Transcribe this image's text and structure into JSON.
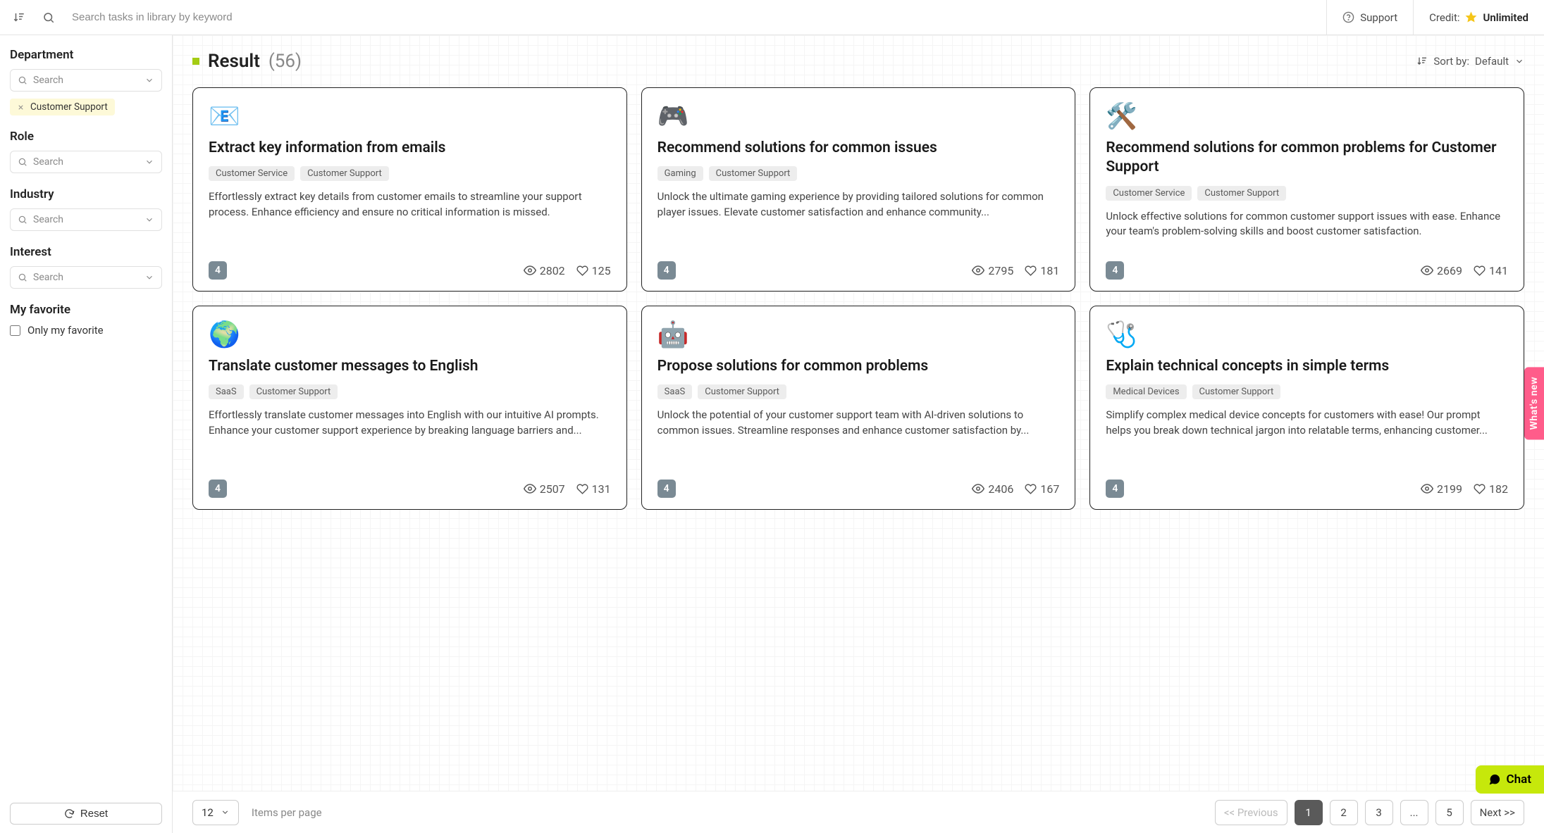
{
  "topbar": {
    "search_placeholder": "Search tasks in library by keyword",
    "support_label": "Support",
    "credit_label": "Credit:",
    "credit_value": "Unlimited"
  },
  "sidebar": {
    "filters": {
      "department": {
        "heading": "Department",
        "placeholder": "Search",
        "chip": "Customer Support"
      },
      "role": {
        "heading": "Role",
        "placeholder": "Search"
      },
      "industry": {
        "heading": "Industry",
        "placeholder": "Search"
      },
      "interest": {
        "heading": "Interest",
        "placeholder": "Search"
      }
    },
    "favorite": {
      "heading": "My favorite",
      "checkbox_label": "Only my favorite"
    },
    "reset_label": "Reset"
  },
  "result": {
    "title": "Result",
    "count": "(56)",
    "sort_prefix": "Sort by:",
    "sort_value": "Default"
  },
  "cards": [
    {
      "emoji": "📧",
      "title": "Extract key information from emails",
      "tags": [
        "Customer Service",
        "Customer Support"
      ],
      "desc": "Effortlessly extract key details from customer emails to streamline your support process. Enhance efficiency and ensure no critical information is missed.",
      "rating": "4",
      "views": "2802",
      "likes": "125"
    },
    {
      "emoji": "🎮",
      "title": "Recommend solutions for common issues",
      "tags": [
        "Gaming",
        "Customer Support"
      ],
      "desc": "Unlock the ultimate gaming experience by providing tailored solutions for common player issues. Elevate customer satisfaction and enhance community...",
      "rating": "4",
      "views": "2795",
      "likes": "181"
    },
    {
      "emoji": "🛠️",
      "title": "Recommend solutions for common problems for Customer Support",
      "tags": [
        "Customer Service",
        "Customer Support"
      ],
      "desc": "Unlock effective solutions for common customer support issues with ease. Enhance your team's problem-solving skills and boost customer satisfaction.",
      "rating": "4",
      "views": "2669",
      "likes": "141"
    },
    {
      "emoji": "🌍",
      "title": "Translate customer messages to English",
      "tags": [
        "SaaS",
        "Customer Support"
      ],
      "desc": "Effortlessly translate customer messages into English with our intuitive AI prompts. Enhance your customer support experience by breaking language barriers and...",
      "rating": "4",
      "views": "2507",
      "likes": "131"
    },
    {
      "emoji": "🤖",
      "title": "Propose solutions for common problems",
      "tags": [
        "SaaS",
        "Customer Support"
      ],
      "desc": "Unlock the potential of your customer support team with AI-driven solutions to common issues. Streamline responses and enhance customer satisfaction by...",
      "rating": "4",
      "views": "2406",
      "likes": "167"
    },
    {
      "emoji": "🩺",
      "title": "Explain technical concepts in simple terms",
      "tags": [
        "Medical Devices",
        "Customer Support"
      ],
      "desc": "Simplify complex medical device concepts for customers with ease! Our prompt helps you break down technical jargon into relatable terms, enhancing customer...",
      "rating": "4",
      "views": "2199",
      "likes": "182"
    }
  ],
  "pager": {
    "per_page": "12",
    "per_page_label": "Items per page",
    "prev": "<< Previous",
    "pages": [
      "1",
      "2",
      "3",
      "...",
      "5"
    ],
    "active_page": "1",
    "next": "Next >>"
  },
  "floats": {
    "whats_new": "What's new",
    "chat": "Chat"
  }
}
